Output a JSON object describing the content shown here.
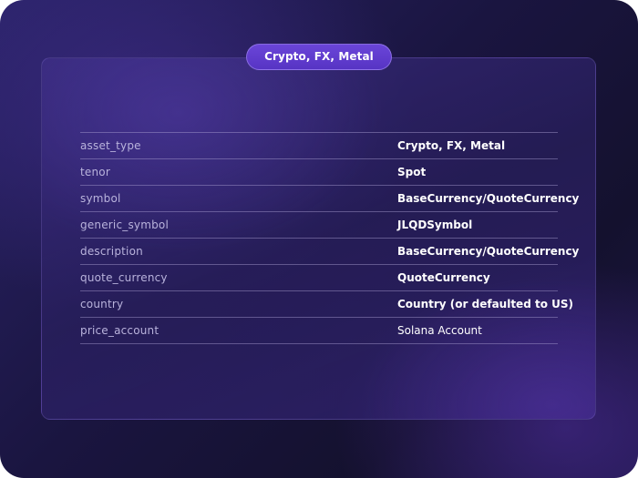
{
  "badge": {
    "label": "Crypto, FX, Metal"
  },
  "table": {
    "rows": [
      {
        "key": "asset_type",
        "value": "Crypto, FX, Metal"
      },
      {
        "key": "tenor",
        "value": "Spot"
      },
      {
        "key": "symbol",
        "value": "BaseCurrency/QuoteCurrency"
      },
      {
        "key": "generic_symbol",
        "value": "JLQDSymbol"
      },
      {
        "key": "description",
        "value": "BaseCurrency/QuoteCurrency"
      },
      {
        "key": "quote_currency",
        "value": "QuoteCurrency"
      },
      {
        "key": "country",
        "value": "Country (or defaulted to US)"
      },
      {
        "key": "price_account",
        "value": "Solana Account"
      }
    ]
  },
  "colors": {
    "background": "#1a1540",
    "badge": "#5f3bd0",
    "key_text": "#b9b3dc",
    "value_text": "#ffffff"
  }
}
